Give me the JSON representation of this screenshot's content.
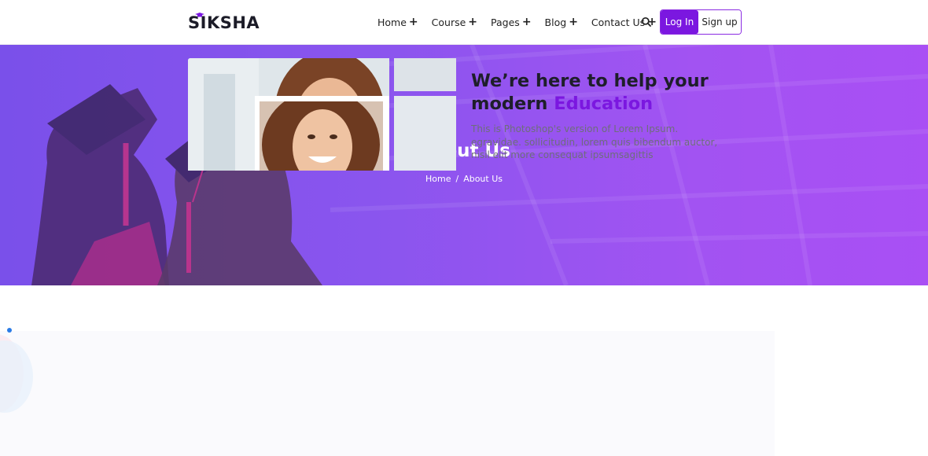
{
  "brand": {
    "name": "SIKSHA",
    "accent_color": "#7b17e0"
  },
  "nav": {
    "items": [
      {
        "label": "Home",
        "suffix": "+"
      },
      {
        "label": "Course",
        "suffix": "+"
      },
      {
        "label": "Pages",
        "suffix": "+"
      },
      {
        "label": "Blog",
        "suffix": "+"
      },
      {
        "label": "Contact Us",
        "suffix": "+"
      }
    ],
    "search_icon": "search-icon",
    "login_label": "Log In",
    "signup_label": "Sign up"
  },
  "hero": {
    "title": "About Us",
    "breadcrumb": {
      "home": "Home",
      "separator": "/",
      "current": "About Us"
    },
    "gradient_colors": [
      "#7a50ea",
      "#a94ff4"
    ]
  },
  "about": {
    "heading_line1": "We’re here to help your",
    "heading_line2_prefix": "modern ",
    "heading_accent": "Education",
    "description": "This is Photoshop's version of Lorem Ipsum. egravidae. sollicitudin, lorem quis bibendum auctor, nisil elit more consequat ipsumsagittis"
  }
}
